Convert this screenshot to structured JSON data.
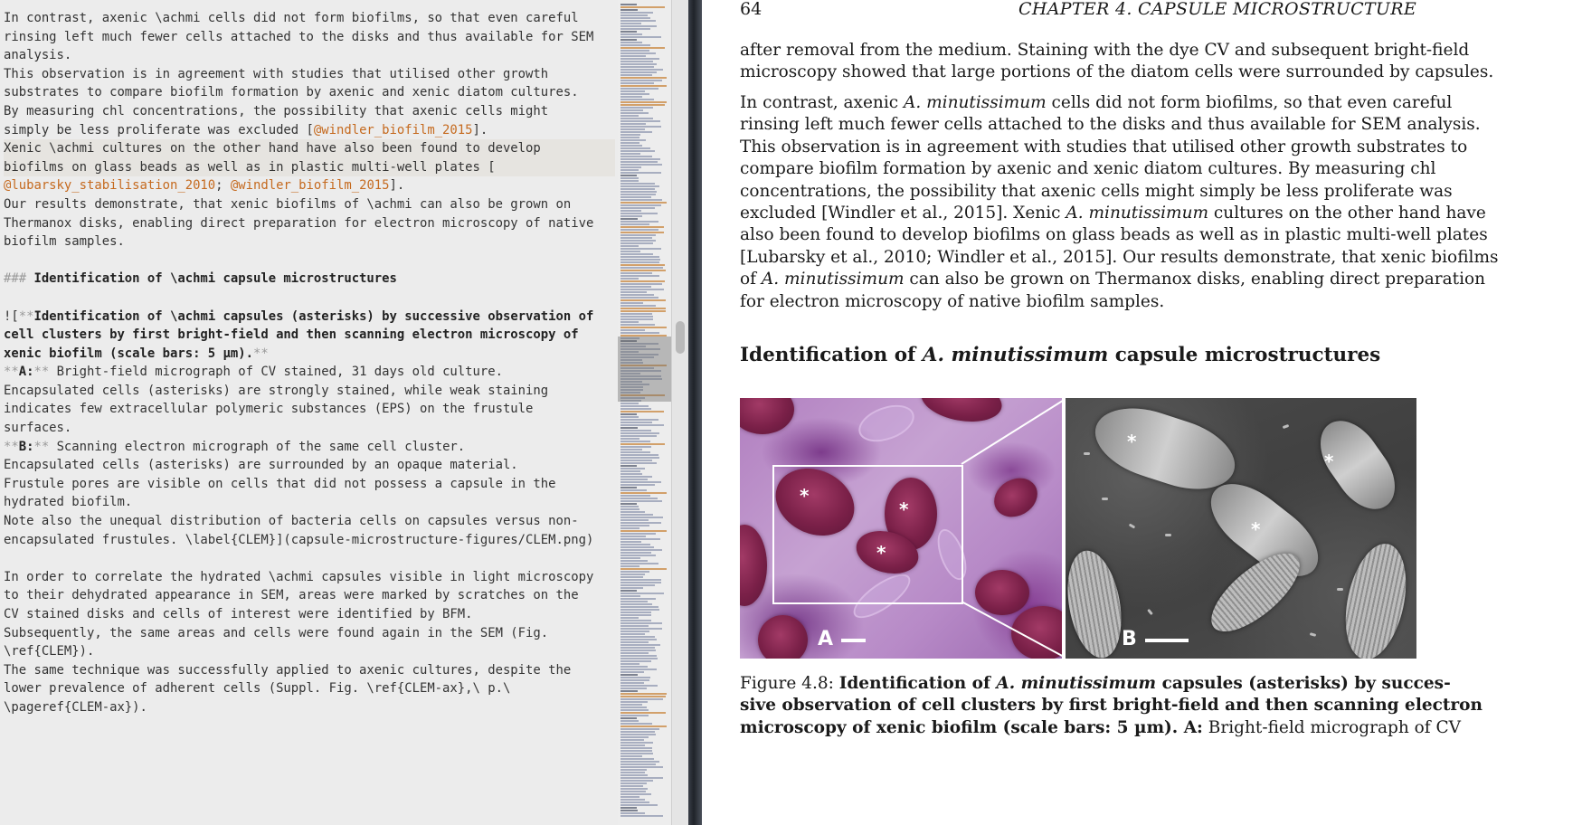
{
  "editor": {
    "lines": [
      [
        {
          "t": "In contrast, axenic \\achmi cells did not form biofilms, so that even careful"
        }
      ],
      [
        {
          "t": "rinsing left much fewer cells attached to the disks and thus available for SEM"
        }
      ],
      [
        {
          "t": "analysis."
        }
      ],
      [
        {
          "t": "This observation is in agreement with studies that utilised other growth"
        }
      ],
      [
        {
          "t": "substrates to compare biofilm formation by axenic and xenic diatom cultures."
        }
      ],
      [
        {
          "t": "By measuring chl concentrations, the possibility that axenic cells might"
        }
      ],
      [
        {
          "t": "simply be less proliferate was excluded ["
        },
        {
          "t": "@windler_biofilm_2015",
          "c": "ref"
        },
        {
          "t": "]."
        }
      ],
      [
        {
          "t": "Xenic \\achmi cultures on the other hand have also been found to develop"
        }
      ],
      [
        {
          "t": "biofilms on glass beads as well as in plastic multi-well plates ["
        }
      ],
      [
        {
          "t": "@lubarsky_stabilisation_2010",
          "c": "ref"
        },
        {
          "t": "; "
        },
        {
          "t": "@windler_biofilm_2015",
          "c": "ref"
        },
        {
          "t": "]."
        }
      ],
      [
        {
          "t": "Our results demonstrate, that xenic biofilms of \\achmi can also be grown on"
        }
      ],
      [
        {
          "t": "Thermanox disks, enabling direct preparation for electron microscopy of native"
        }
      ],
      [
        {
          "t": "biofilm samples."
        }
      ],
      [
        {
          "t": ""
        }
      ],
      [
        {
          "t": "### ",
          "c": "mk"
        },
        {
          "t": "Identification of \\achmi capsule microstructures",
          "c": "bold"
        }
      ],
      [
        {
          "t": ""
        }
      ],
      [
        {
          "t": "![",
          "c": ""
        },
        {
          "t": "**",
          "c": "mk"
        },
        {
          "t": "Identification of \\achmi capsules (asterisks) by successive observation of",
          "c": "bold"
        }
      ],
      [
        {
          "t": "cell clusters by first bright-field and then scanning electron microscopy of",
          "c": "bold"
        }
      ],
      [
        {
          "t": "xenic biofilm (scale bars: 5 µm).",
          "c": "bold"
        },
        {
          "t": "**",
          "c": "mk"
        }
      ],
      [
        {
          "t": "**",
          "c": "mk"
        },
        {
          "t": "A:",
          "c": "bold"
        },
        {
          "t": "**",
          "c": "mk"
        },
        {
          "t": " Bright-field micrograph of CV stained, 31 days old culture."
        }
      ],
      [
        {
          "t": "Encapsulated cells (asterisks) are strongly stained, while weak staining"
        }
      ],
      [
        {
          "t": "indicates few extracellular polymeric substances (EPS) on the frustule"
        }
      ],
      [
        {
          "t": "surfaces."
        }
      ],
      [
        {
          "t": "**",
          "c": "mk"
        },
        {
          "t": "B:",
          "c": "bold"
        },
        {
          "t": "**",
          "c": "mk"
        },
        {
          "t": " Scanning electron micrograph of the same cell cluster."
        }
      ],
      [
        {
          "t": "Encapsulated cells (asterisks) are surrounded by an opaque material."
        }
      ],
      [
        {
          "t": "Frustule pores are visible on cells that did not possess a capsule in the"
        }
      ],
      [
        {
          "t": "hydrated biofilm."
        }
      ],
      [
        {
          "t": "Note also the unequal distribution of bacteria cells on capsules versus non-"
        }
      ],
      [
        {
          "t": "encapsulated frustules. \\label{CLEM}](capsule-microstructure-figures/CLEM.png)"
        }
      ],
      [
        {
          "t": ""
        }
      ],
      [
        {
          "t": "In order to correlate the hydrated \\achmi capsules visible in light microscopy"
        }
      ],
      [
        {
          "t": "to their dehydrated appearance in SEM, areas were marked by scratches on the"
        }
      ],
      [
        {
          "t": "CV stained disks and cells of interest were identified by BFM."
        }
      ],
      [
        {
          "t": "Subsequently, the same areas and cells were found again in the SEM (Fig."
        }
      ],
      [
        {
          "t": "\\ref{CLEM})."
        }
      ],
      [
        {
          "t": "The same technique was successfully applied to axenic cultures, despite the"
        }
      ],
      [
        {
          "t": "lower prevalence of adherent cells (Suppl. Fig. \\ref{CLEM-ax},\\ p.\\"
        }
      ],
      [
        {
          "t": "\\pageref{CLEM-ax})."
        }
      ]
    ]
  },
  "pdf": {
    "page_number": "64",
    "chapter": "CHAPTER 4.  CAPSULE MICROSTRUCTURE",
    "p1": [
      [
        {
          "t": "after removal from the medium. Staining with the dye CV and subsequent bright-field"
        }
      ],
      [
        {
          "t": "microscopy showed that large portions of the diatom cells were surrounded by capsules."
        }
      ]
    ],
    "p2": [
      [
        {
          "t": "    In contrast, axenic "
        },
        {
          "t": "A. minutissimum",
          "i": true
        },
        {
          "t": " cells did not form biofilms, so that even careful"
        }
      ],
      [
        {
          "t": "rinsing left much fewer cells attached to the disks and thus available for SEM analysis."
        }
      ],
      [
        {
          "t": "This observation is in agreement with studies that utilised other growth substrates to"
        }
      ],
      [
        {
          "t": "compare biofilm formation by axenic and xenic diatom cultures.  By measuring chl"
        }
      ],
      [
        {
          "t": "concentrations, the possibility that axenic cells might simply be less proliferate was"
        }
      ],
      [
        {
          "t": "excluded [Windler et al., 2015]. Xenic "
        },
        {
          "t": "A. minutissimum",
          "i": true
        },
        {
          "t": " cultures on the other hand have"
        }
      ],
      [
        {
          "t": "also been found to develop biofilms on glass beads as well as in plastic multi-well plates"
        }
      ],
      [
        {
          "t": "[Lubarsky et al., 2010; Windler et al., 2015]. Our results demonstrate, that xenic biofilms"
        }
      ],
      [
        {
          "t": "of "
        },
        {
          "t": "A. minutissimum",
          "i": true
        },
        {
          "t": " can also be grown on Thermanox disks, enabling direct preparation"
        }
      ],
      [
        {
          "t": "for electron microscopy of native biofilm samples."
        }
      ]
    ],
    "section_title": [
      {
        "t": "Identification of "
      },
      {
        "t": "A. minutissimum",
        "i": true
      },
      {
        "t": " capsule microstructures"
      }
    ],
    "figure": {
      "label_a": "A",
      "label_b": "B",
      "asterisk": "*"
    },
    "caption": [
      [
        {
          "t": "Figure 4.8: "
        },
        {
          "t": "Identification of ",
          "b": true
        },
        {
          "t": "A. minutissimum",
          "b": true,
          "i": true
        },
        {
          "t": " capsules (asterisks) by succes-",
          "b": true
        }
      ],
      [
        {
          "t": "sive observation of cell clusters by first bright-field and then scanning electron",
          "b": true
        }
      ],
      [
        {
          "t": "microscopy of xenic biofilm (scale bars: 5 µm). ",
          "b": true
        },
        {
          "t": "A:",
          "b": true
        },
        {
          "t": " Bright-field micrograph of CV"
        }
      ]
    ]
  },
  "colors": {
    "editor_bg": "#ececec",
    "reference": "#c56a1f",
    "markup": "#9a9a9a"
  }
}
